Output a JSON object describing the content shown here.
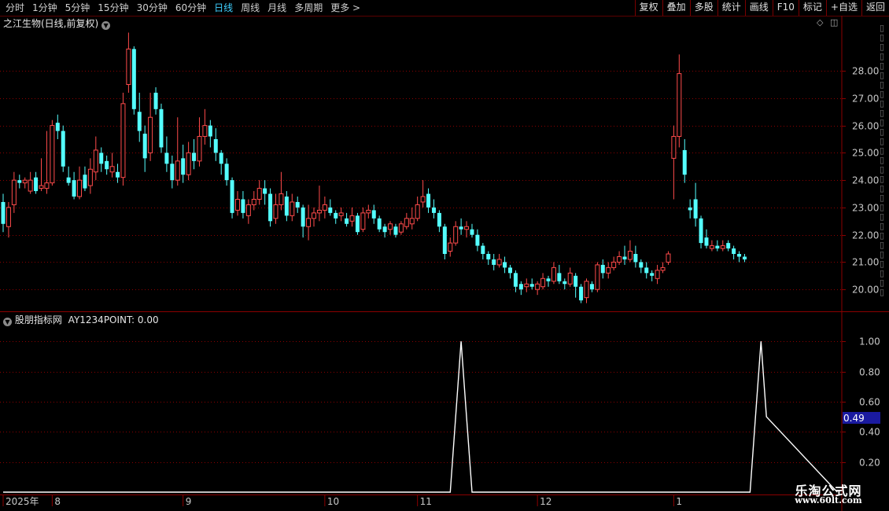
{
  "periods": [
    {
      "label": "分时",
      "active": false
    },
    {
      "label": "1分钟",
      "active": false
    },
    {
      "label": "5分钟",
      "active": false
    },
    {
      "label": "15分钟",
      "active": false
    },
    {
      "label": "30分钟",
      "active": false
    },
    {
      "label": "60分钟",
      "active": false
    },
    {
      "label": "日线",
      "active": true
    },
    {
      "label": "周线",
      "active": false
    },
    {
      "label": "月线",
      "active": false
    },
    {
      "label": "多周期",
      "active": false
    },
    {
      "label": "更多 >",
      "active": false
    }
  ],
  "tools": [
    "复权",
    "叠加",
    "多股",
    "统计",
    "画线",
    "F10",
    "标记",
    "+自选",
    "返回"
  ],
  "main_panel": {
    "title": "之江生物(日线,前复权)"
  },
  "indicator_panel": {
    "title": "股朋指标网",
    "value_text": "AY1234POINT: 0.00",
    "cursor_value": "0.49"
  },
  "watermark": {
    "line1": "乐淘公式网",
    "line2": "www.60lt.com"
  },
  "colors": {
    "up": "#ff4b4b",
    "down": "#54ffff",
    "grid": "#8b0000",
    "bg": "#000000",
    "text": "#c8c8c8"
  },
  "chart_data": [
    {
      "type": "candlestick",
      "name": "之江生物",
      "y_ticks": [
        20.0,
        21.0,
        22.0,
        23.0,
        24.0,
        25.0,
        26.0,
        27.0,
        28.0
      ],
      "ylim": [
        19.2,
        29.5
      ],
      "x_axis_labels": [
        "2025年",
        "8",
        "9",
        "10",
        "11",
        "12",
        "1"
      ],
      "x_label_index": [
        0,
        9,
        33,
        59,
        76,
        98,
        123
      ],
      "candles": [
        [
          23.2,
          22.4,
          23.5,
          22.1
        ],
        [
          22.3,
          23.0,
          23.2,
          21.9
        ],
        [
          23.1,
          24.0,
          24.3,
          22.8
        ],
        [
          24.0,
          23.9,
          24.2,
          23.7
        ],
        [
          23.9,
          24.0,
          24.1,
          23.7
        ],
        [
          23.6,
          24.0,
          24.3,
          23.5
        ],
        [
          24.1,
          23.6,
          24.3,
          23.5
        ],
        [
          23.7,
          23.8,
          24.8,
          23.6
        ],
        [
          23.7,
          23.9,
          25.8,
          23.5
        ],
        [
          23.9,
          26.0,
          26.2,
          23.8
        ],
        [
          26.1,
          25.8,
          26.4,
          25.5
        ],
        [
          25.8,
          24.5,
          26.0,
          24.3
        ],
        [
          24.1,
          23.9,
          24.5,
          23.8
        ],
        [
          24.0,
          23.4,
          24.3,
          23.3
        ],
        [
          23.4,
          24.0,
          24.5,
          23.3
        ],
        [
          24.2,
          23.7,
          24.5,
          23.6
        ],
        [
          23.8,
          24.4,
          24.8,
          23.5
        ],
        [
          24.3,
          25.1,
          25.6,
          24.0
        ],
        [
          25.0,
          24.6,
          25.2,
          24.3
        ],
        [
          24.7,
          24.4,
          24.9,
          24.2
        ],
        [
          24.3,
          24.5,
          25.0,
          24.1
        ],
        [
          24.3,
          24.1,
          24.6,
          23.9
        ],
        [
          24.1,
          26.8,
          27.2,
          23.8
        ],
        [
          27.5,
          28.8,
          29.4,
          27.2
        ],
        [
          28.8,
          26.6,
          28.9,
          26.4
        ],
        [
          26.5,
          25.8,
          27.2,
          25.4
        ],
        [
          25.7,
          24.8,
          26.0,
          24.3
        ],
        [
          25.0,
          26.3,
          27.2,
          24.7
        ],
        [
          27.2,
          26.6,
          27.4,
          26.4
        ],
        [
          26.6,
          25.2,
          26.8,
          25.0
        ],
        [
          25.0,
          24.6,
          25.6,
          24.3
        ],
        [
          24.6,
          24.0,
          24.9,
          23.7
        ],
        [
          24.0,
          24.7,
          26.3,
          23.8
        ],
        [
          24.8,
          24.2,
          25.3,
          23.9
        ],
        [
          24.2,
          25.0,
          25.4,
          24.0
        ],
        [
          25.0,
          24.7,
          25.5,
          24.4
        ],
        [
          24.7,
          25.6,
          26.3,
          24.5
        ],
        [
          25.6,
          26.0,
          26.6,
          25.3
        ],
        [
          26.0,
          25.6,
          26.2,
          25.2
        ],
        [
          25.5,
          25.0,
          25.9,
          24.7
        ],
        [
          25.0,
          24.6,
          25.1,
          24.2
        ],
        [
          24.6,
          24.0,
          24.8,
          23.8
        ],
        [
          24.0,
          22.8,
          24.1,
          22.6
        ],
        [
          22.9,
          23.3,
          23.6,
          22.7
        ],
        [
          23.3,
          22.8,
          23.6,
          22.6
        ],
        [
          22.7,
          23.1,
          23.3,
          22.4
        ],
        [
          23.1,
          23.3,
          23.6,
          22.9
        ],
        [
          23.3,
          23.7,
          24.0,
          23.1
        ],
        [
          23.7,
          23.5,
          24.0,
          23.1
        ],
        [
          23.5,
          22.5,
          23.7,
          22.3
        ],
        [
          22.6,
          23.1,
          23.5,
          22.4
        ],
        [
          23.1,
          23.5,
          24.3,
          22.9
        ],
        [
          23.4,
          22.7,
          23.6,
          22.5
        ],
        [
          22.7,
          23.2,
          23.5,
          22.5
        ],
        [
          23.2,
          23.0,
          23.4,
          22.8
        ],
        [
          23.0,
          22.3,
          23.1,
          21.9
        ],
        [
          22.3,
          22.6,
          23.1,
          21.8
        ],
        [
          22.6,
          22.8,
          23.0,
          22.3
        ],
        [
          22.8,
          22.9,
          23.8,
          22.5
        ],
        [
          22.9,
          23.1,
          23.4,
          22.6
        ],
        [
          23.0,
          22.8,
          23.3,
          22.7
        ],
        [
          22.8,
          22.6,
          22.9,
          22.4
        ],
        [
          22.7,
          22.8,
          23.0,
          22.5
        ],
        [
          22.6,
          22.4,
          22.8,
          22.3
        ],
        [
          22.5,
          22.7,
          23.0,
          22.3
        ],
        [
          22.7,
          22.1,
          22.8,
          22.0
        ],
        [
          22.2,
          22.8,
          23.0,
          22.1
        ],
        [
          22.8,
          22.9,
          23.1,
          22.6
        ],
        [
          22.9,
          22.6,
          23.1,
          22.4
        ],
        [
          22.6,
          22.2,
          22.7,
          22.1
        ],
        [
          22.3,
          22.1,
          22.4,
          21.9
        ],
        [
          22.2,
          22.4,
          22.5,
          22.0
        ],
        [
          22.3,
          22.0,
          22.4,
          21.9
        ],
        [
          22.1,
          22.4,
          22.5,
          22.0
        ],
        [
          22.3,
          22.6,
          22.8,
          22.2
        ],
        [
          22.4,
          22.6,
          23.0,
          22.2
        ],
        [
          22.6,
          23.1,
          23.4,
          22.5
        ],
        [
          23.2,
          23.4,
          24.0,
          23.0
        ],
        [
          23.5,
          23.0,
          23.7,
          22.8
        ],
        [
          23.0,
          22.8,
          23.3,
          22.6
        ],
        [
          22.8,
          22.3,
          22.9,
          22.1
        ],
        [
          22.3,
          21.3,
          22.4,
          21.1
        ],
        [
          21.4,
          21.7,
          21.9,
          21.2
        ],
        [
          21.7,
          22.3,
          22.5,
          21.6
        ],
        [
          22.3,
          22.2,
          22.6,
          22.0
        ],
        [
          22.2,
          22.3,
          22.5,
          21.9
        ],
        [
          22.2,
          22.0,
          22.4,
          21.9
        ],
        [
          22.0,
          21.6,
          22.2,
          21.4
        ],
        [
          21.6,
          21.3,
          21.7,
          21.1
        ],
        [
          21.3,
          21.1,
          21.4,
          20.9
        ],
        [
          21.1,
          20.9,
          21.3,
          20.7
        ],
        [
          20.9,
          21.1,
          21.3,
          20.8
        ],
        [
          21.0,
          20.8,
          21.2,
          20.6
        ],
        [
          20.8,
          20.6,
          20.9,
          20.4
        ],
        [
          20.6,
          20.1,
          20.7,
          19.9
        ],
        [
          20.2,
          20.0,
          20.3,
          19.8
        ],
        [
          20.1,
          20.2,
          20.4,
          19.9
        ],
        [
          20.2,
          20.1,
          20.4,
          20.0
        ],
        [
          20.0,
          20.2,
          20.3,
          19.8
        ],
        [
          20.1,
          20.4,
          20.6,
          20.0
        ],
        [
          20.4,
          20.3,
          20.5,
          20.1
        ],
        [
          20.3,
          20.8,
          21.0,
          20.2
        ],
        [
          20.6,
          20.3,
          20.9,
          20.2
        ],
        [
          20.3,
          20.2,
          20.4,
          20.0
        ],
        [
          20.2,
          20.6,
          20.8,
          20.1
        ],
        [
          20.5,
          20.1,
          20.6,
          19.7
        ],
        [
          20.1,
          19.6,
          20.2,
          19.5
        ],
        [
          19.7,
          20.3,
          20.4,
          19.5
        ],
        [
          20.2,
          20.0,
          20.3,
          19.9
        ],
        [
          20.0,
          20.9,
          21.0,
          19.9
        ],
        [
          20.9,
          20.6,
          21.1,
          20.4
        ],
        [
          20.6,
          20.8,
          21.0,
          20.4
        ],
        [
          20.8,
          21.0,
          21.2,
          20.7
        ],
        [
          21.0,
          21.2,
          21.4,
          20.9
        ],
        [
          21.2,
          21.1,
          21.6,
          20.9
        ],
        [
          21.1,
          21.4,
          21.8,
          21.0
        ],
        [
          21.3,
          21.0,
          21.6,
          20.8
        ],
        [
          21.0,
          20.8,
          21.1,
          20.6
        ],
        [
          20.8,
          20.6,
          21.0,
          20.4
        ],
        [
          20.6,
          20.5,
          20.7,
          20.3
        ],
        [
          20.4,
          20.7,
          20.9,
          20.2
        ],
        [
          20.7,
          20.8,
          21.0,
          20.6
        ],
        [
          21.0,
          21.3,
          21.4,
          20.9
        ],
        [
          24.8,
          25.6,
          26.0,
          23.3
        ],
        [
          25.6,
          27.9,
          28.6,
          25.2
        ],
        [
          25.1,
          24.2,
          25.5,
          23.9
        ],
        [
          23.0,
          22.9,
          23.3,
          22.6
        ],
        [
          23.3,
          22.6,
          23.9,
          22.3
        ],
        [
          22.6,
          21.7,
          22.7,
          21.5
        ],
        [
          21.9,
          21.6,
          22.2,
          21.5
        ],
        [
          21.5,
          21.6,
          21.8,
          21.4
        ],
        [
          21.6,
          21.5,
          21.8,
          21.4
        ],
        [
          21.5,
          21.6,
          21.8,
          21.4
        ],
        [
          21.7,
          21.5,
          21.8,
          21.4
        ],
        [
          21.5,
          21.3,
          21.6,
          21.1
        ],
        [
          21.3,
          21.2,
          21.4,
          21.0
        ],
        [
          21.2,
          21.1,
          21.3,
          21.0
        ]
      ]
    },
    {
      "type": "line",
      "name": "AY1234POINT",
      "y_ticks": [
        0.2,
        0.4,
        0.6,
        0.8,
        1.0
      ],
      "ylim": [
        0,
        1.1
      ],
      "x": [
        0,
        82,
        83,
        84,
        85,
        86,
        136,
        137,
        138,
        139,
        140,
        153
      ],
      "y": [
        0,
        0,
        0.5,
        1,
        0.5,
        0,
        0,
        0,
        0.5,
        1,
        0.5,
        0
      ]
    }
  ]
}
